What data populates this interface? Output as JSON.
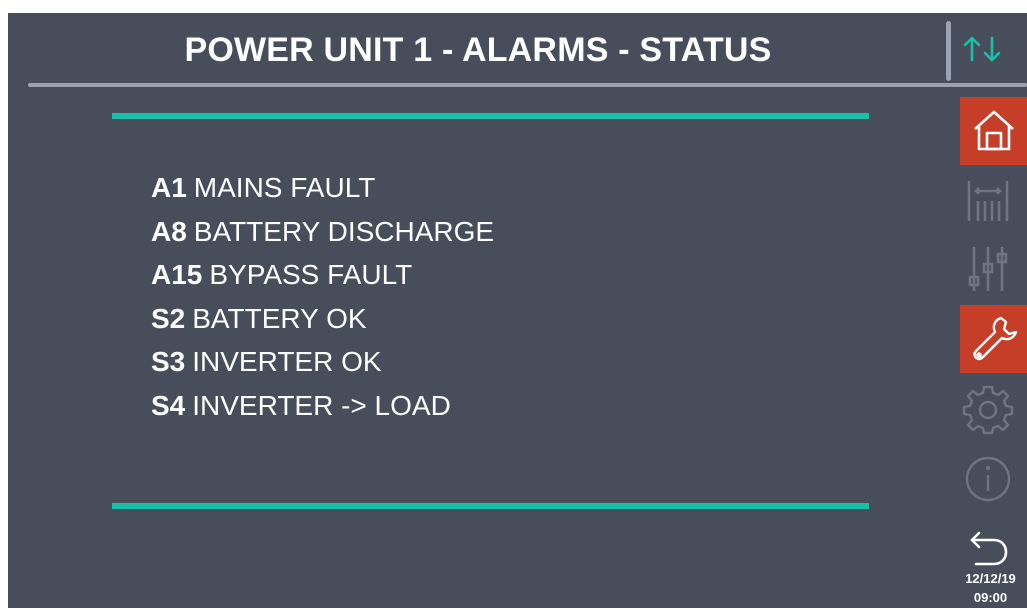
{
  "header": {
    "title": "POWER UNIT 1 - ALARMS - STATUS"
  },
  "alarms": [
    {
      "code": "A1",
      "text": "MAINS FAULT"
    },
    {
      "code": "A8",
      "text": "BATTERY DISCHARGE"
    },
    {
      "code": "A15",
      "text": "BYPASS FAULT"
    },
    {
      "code": "S2",
      "text": "BATTERY OK"
    },
    {
      "code": "S3",
      "text": "INVERTER OK"
    },
    {
      "code": "S4",
      "text": "INVERTER -> LOAD"
    }
  ],
  "sidebar": {
    "items": [
      {
        "icon": "home-icon",
        "state": "active"
      },
      {
        "icon": "measurements-icon",
        "state": "disabled"
      },
      {
        "icon": "sliders-icon",
        "state": "disabled"
      },
      {
        "icon": "wrench-icon",
        "state": "active"
      },
      {
        "icon": "gear-icon",
        "state": "disabled"
      },
      {
        "icon": "info-icon",
        "state": "disabled"
      },
      {
        "icon": "back-arrow-icon",
        "state": "enabled"
      }
    ],
    "top_icon": "up-down-arrows-icon"
  },
  "status": {
    "date": "12/12/19",
    "time": "09:00"
  },
  "colors": {
    "background": "#474d5a",
    "accent_teal": "#19bfa8",
    "active_red": "#c63e28",
    "disabled_icon": "#6d7482",
    "text": "#ffffff"
  }
}
